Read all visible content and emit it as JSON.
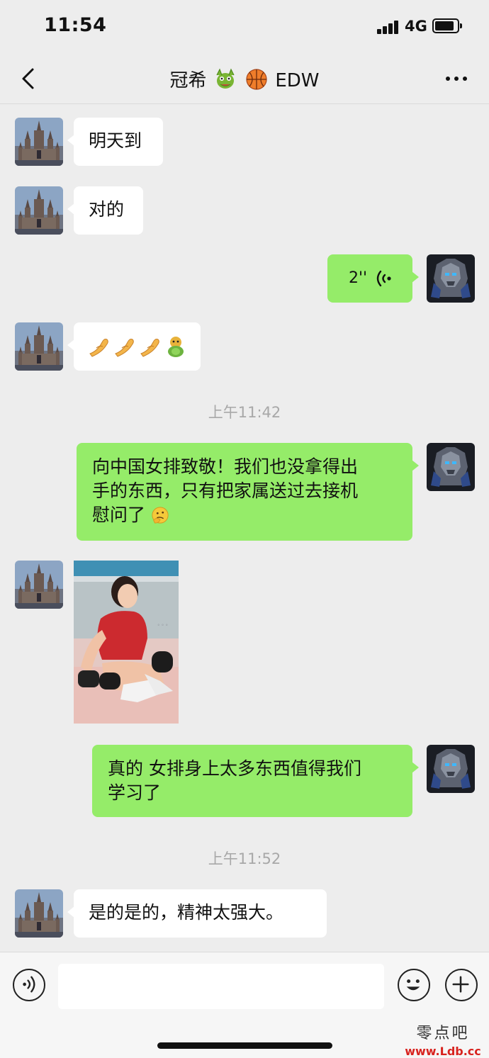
{
  "status_bar": {
    "time": "11:54",
    "network": "4G"
  },
  "header": {
    "title_left": "冠希",
    "title_right": "EDW",
    "title_emojis": [
      "dragon-emoji",
      "basketball-emoji"
    ]
  },
  "messages": [
    {
      "side": "in",
      "type": "text",
      "text": "明天到"
    },
    {
      "side": "in",
      "type": "text",
      "text": "对的"
    },
    {
      "side": "out",
      "type": "voice",
      "duration": "2''"
    },
    {
      "side": "in",
      "type": "emoji",
      "emojis": [
        "pinch-hand-emoji",
        "pinch-hand-emoji",
        "pinch-hand-emoji",
        "green-figure-emoji"
      ]
    },
    {
      "type": "time",
      "text": "上午11:42"
    },
    {
      "side": "out",
      "type": "text",
      "lines": [
        "向中国女排致敬！我们也没拿得出",
        "手的东西，只有把家属送过去接机",
        "慰问了"
      ]
    },
    {
      "side": "in",
      "type": "image",
      "image": "photo-volleyball-player"
    },
    {
      "side": "out",
      "type": "text",
      "lines": [
        "真的 女排身上太多东西值得我们",
        "学习了"
      ]
    },
    {
      "type": "time",
      "text": "上午11:52"
    },
    {
      "side": "in",
      "type": "text",
      "text": "是的是的，精神太强大。"
    }
  ],
  "input": {
    "placeholder": "",
    "value": ""
  },
  "watermark": {
    "name": "零点吧",
    "url": "www.Ldb.cc"
  }
}
